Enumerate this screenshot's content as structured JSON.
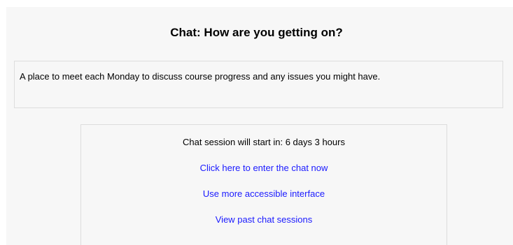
{
  "page": {
    "title": "Chat: How are you getting on?"
  },
  "intro": {
    "text": "A place to meet each Monday to discuss course progress and any issues you might have."
  },
  "chat": {
    "session_info": "Chat session will start in: 6 days 3 hours",
    "links": [
      {
        "label": "Click here to enter the chat now"
      },
      {
        "label": "Use more accessible interface"
      },
      {
        "label": "View past chat sessions"
      }
    ]
  },
  "colors": {
    "link": "#1a1aff",
    "background": "#f7f7f7",
    "border": "#dddddd"
  }
}
